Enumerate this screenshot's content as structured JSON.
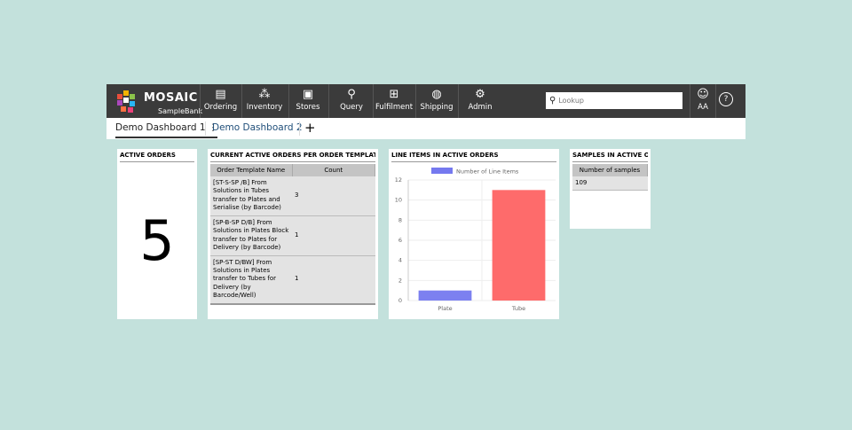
{
  "brand": {
    "name": "MOSAIC",
    "product": "SampleBank"
  },
  "nav": [
    {
      "label": "Ordering",
      "icon": "clipboard-icon"
    },
    {
      "label": "Inventory",
      "icon": "grid-icon"
    },
    {
      "label": "Stores",
      "icon": "box-icon"
    },
    {
      "label": "Query",
      "icon": "search-icon"
    },
    {
      "label": "Fulfilment",
      "icon": "hierarchy-icon"
    },
    {
      "label": "Shipping",
      "icon": "globe-icon"
    },
    {
      "label": "Admin",
      "icon": "gear-icon"
    }
  ],
  "search": {
    "placeholder": "Lookup"
  },
  "user": {
    "initials": "AA"
  },
  "tabs": [
    {
      "label": "Demo Dashboard 1",
      "active": true
    },
    {
      "label": "Demo Dashboard 2",
      "active": false
    }
  ],
  "add_tab": "+",
  "widgets": {
    "active_orders": {
      "title": "ACTIVE ORDERS",
      "value": "5"
    },
    "orders_per_template": {
      "title": "CURRENT ACTIVE ORDERS PER ORDER TEMPLATE I...",
      "columns": [
        "Order Template Name",
        "Count"
      ],
      "rows": [
        [
          "[ST-S-SP /B] From Solutions in Tubes transfer to Plates and Serialise (by Barcode)",
          "3"
        ],
        [
          "[SP-B-SP D/B] From Solutions in Plates Block transfer to Plates for Delivery (by Barcode)",
          "1"
        ],
        [
          "[SP-ST D/BW] From Solutions in Plates transfer to Tubes for Delivery (by Barcode/Well)",
          "1"
        ]
      ]
    },
    "line_items": {
      "title": "LINE ITEMS IN ACTIVE ORDERS"
    },
    "samples": {
      "title": "SAMPLES IN ACTIVE O...",
      "column": "Number of samples",
      "value": "109"
    }
  },
  "chart_data": {
    "type": "bar",
    "categories": [
      "Plate",
      "Tube"
    ],
    "series": [
      {
        "name": "Number of Line Items",
        "values": [
          1,
          11
        ],
        "colors": [
          "#7579ef",
          "#fe6363"
        ]
      }
    ],
    "ylim": [
      0,
      12
    ],
    "yticks": [
      0,
      2,
      4,
      6,
      8,
      10,
      12
    ],
    "legend": "top",
    "grid": true
  }
}
